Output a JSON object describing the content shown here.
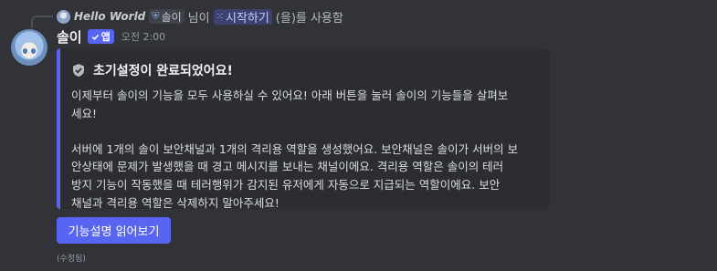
{
  "reply": {
    "username": "Hello World",
    "role_tag": "솔이",
    "mention_suffix": "님이",
    "command": "시작하기",
    "action_text": "(을)를 사용함"
  },
  "message": {
    "username": "솔이",
    "app_tag": "앱",
    "timestamp": "오전 2:00",
    "edited_label": "(수정됨)"
  },
  "embed": {
    "accent_color": "#5865f2",
    "title_icon": "shield-check-icon",
    "title": "초기설정이 완료되었어요!",
    "description": "이제부터 솔이의 기능을 모두 사용하실 수 있어요! 아래 버튼을 눌러 솔이의 기능들을 살펴보\n세요!\n\n서버에 1개의 솔이 보안채널과 1개의 격리용 역할을 생성했어요. 보안채널은 솔이가 서버의 보\n안상태에 문제가 발생했을 때 경고 메시지를 보내는 채널이에요. 격리용 역할은 솔이의 테러\n방지 기능이 작동했을 때 테러행위가 감지된 유저에게 자동으로 지급되는 역할이에요. 보안\n채널과 격리용 역할은 삭제하지 말아주세요!"
  },
  "button": {
    "label": "기능설명 읽어보기"
  }
}
